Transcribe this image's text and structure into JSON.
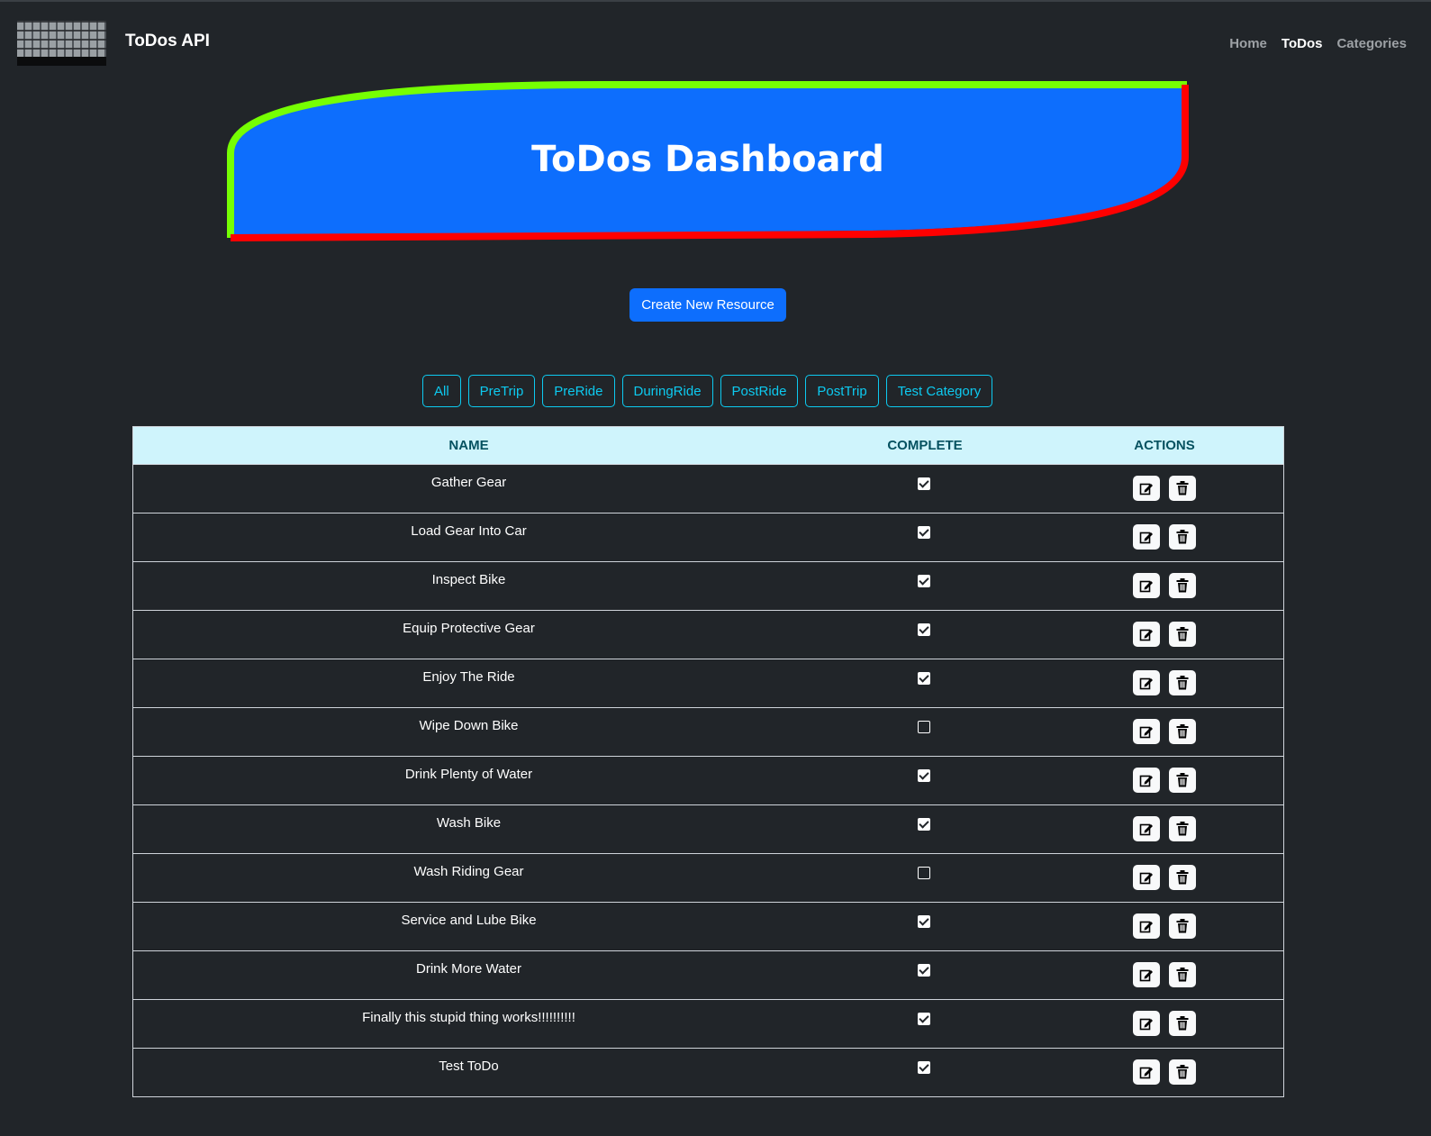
{
  "brand": {
    "title": "ToDos API",
    "logo": "keyboard-logo"
  },
  "nav": {
    "items": [
      "Home",
      "ToDos",
      "Categories"
    ],
    "active": "ToDos"
  },
  "hero": {
    "title": "ToDos Dashboard",
    "fill": "#0d6efd",
    "border_top": "#76ff03",
    "border_bottom": "#ff0000"
  },
  "create_button": {
    "label": "Create New Resource",
    "color": "#0d6efd"
  },
  "filters": [
    "All",
    "PreTrip",
    "PreRide",
    "DuringRide",
    "PostRide",
    "PostTrip",
    "Test Category"
  ],
  "table": {
    "headers": {
      "name": "NAME",
      "complete": "COMPLETE",
      "actions": "ACTIONS"
    },
    "rows": [
      {
        "name": "Gather Gear",
        "complete": true
      },
      {
        "name": "Load Gear Into Car",
        "complete": true
      },
      {
        "name": "Inspect Bike",
        "complete": true
      },
      {
        "name": "Equip Protective Gear",
        "complete": true
      },
      {
        "name": "Enjoy The Ride",
        "complete": true
      },
      {
        "name": "Wipe Down Bike",
        "complete": false
      },
      {
        "name": "Drink Plenty of Water",
        "complete": true
      },
      {
        "name": "Wash Bike",
        "complete": true
      },
      {
        "name": "Wash Riding Gear",
        "complete": false
      },
      {
        "name": "Service and Lube Bike",
        "complete": true
      },
      {
        "name": "Drink More Water",
        "complete": true
      },
      {
        "name": "Finally this stupid thing works!!!!!!!!!!",
        "complete": true
      },
      {
        "name": "Test ToDo",
        "complete": true
      }
    ],
    "row_actions": {
      "edit_icon": "edit-icon",
      "delete_icon": "trash-icon"
    }
  }
}
